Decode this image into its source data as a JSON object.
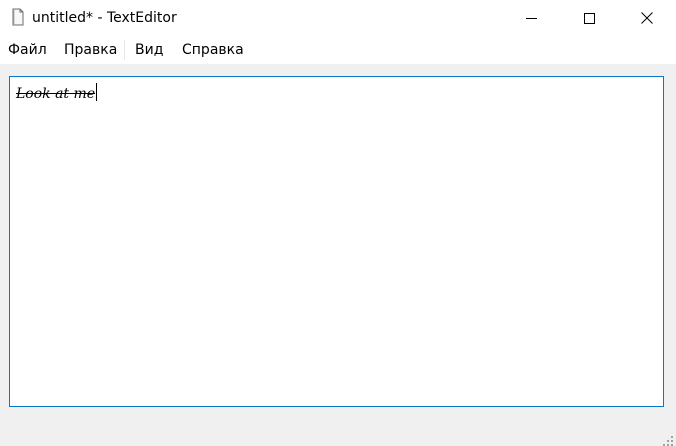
{
  "window": {
    "title": "untitled* - TextEditor",
    "app_icon": "document-icon",
    "controls": {
      "minimize_icon": "minimize-icon",
      "maximize_icon": "maximize-icon",
      "close_icon": "close-icon"
    }
  },
  "menu": {
    "items": [
      {
        "label": "Файл"
      },
      {
        "label": "Правка"
      },
      {
        "label": "Вид"
      },
      {
        "label": "Справка"
      }
    ]
  },
  "editor": {
    "text": "Look at me",
    "style": "italic strikethrough",
    "border_color": "#0a78c2"
  },
  "statusbar": {
    "grip_icon": "resize-grip-icon"
  }
}
